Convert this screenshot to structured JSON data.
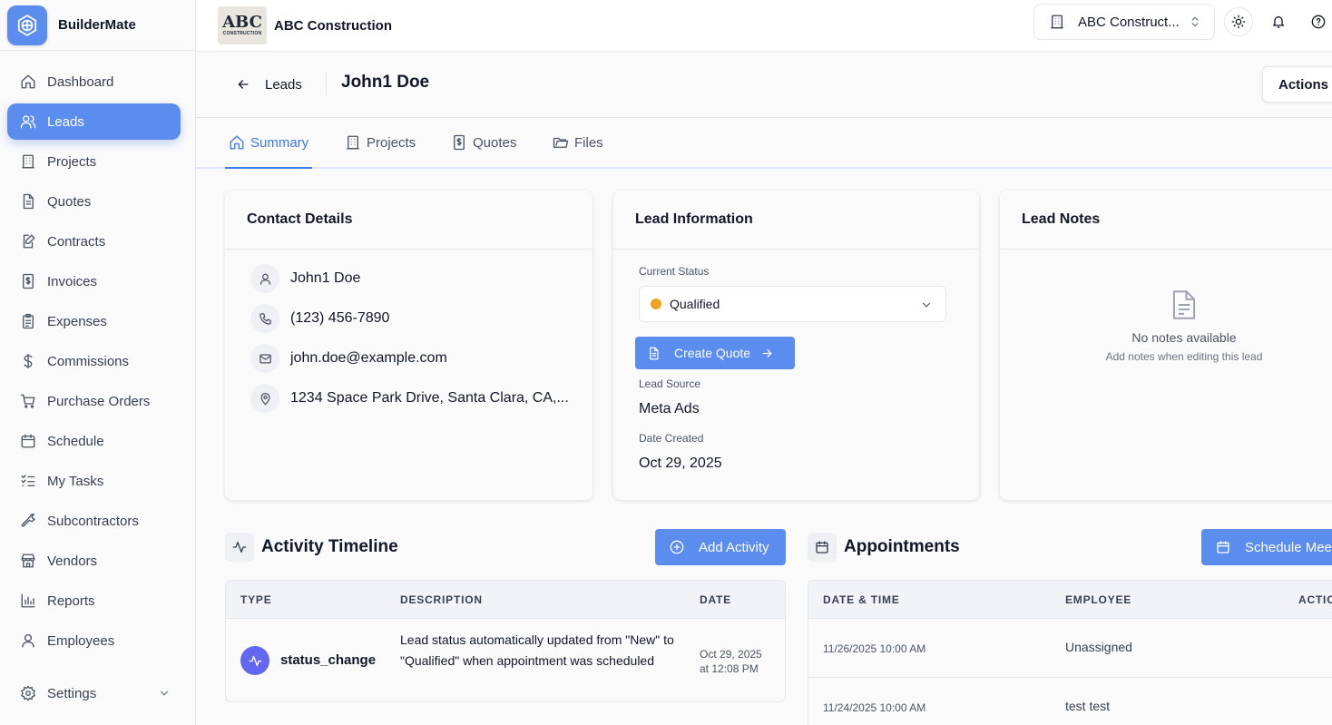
{
  "app": {
    "name": "BuilderMate"
  },
  "sidebar": {
    "items": [
      {
        "label": "Dashboard",
        "icon": "home-icon",
        "active": false
      },
      {
        "label": "Leads",
        "icon": "users-icon",
        "active": true
      },
      {
        "label": "Projects",
        "icon": "building-icon",
        "active": false
      },
      {
        "label": "Quotes",
        "icon": "document-icon",
        "active": false
      },
      {
        "label": "Contracts",
        "icon": "file-pen-icon",
        "active": false
      },
      {
        "label": "Invoices",
        "icon": "dollar-file-icon",
        "active": false
      },
      {
        "label": "Expenses",
        "icon": "clipboard-icon",
        "active": false
      },
      {
        "label": "Commissions",
        "icon": "dollar-icon",
        "active": false
      },
      {
        "label": "Purchase Orders",
        "icon": "cart-icon",
        "active": false
      },
      {
        "label": "Schedule",
        "icon": "calendar-icon",
        "active": false
      },
      {
        "label": "My Tasks",
        "icon": "list-check-icon",
        "active": false
      },
      {
        "label": "Subcontractors",
        "icon": "wrench-icon",
        "active": false
      },
      {
        "label": "Vendors",
        "icon": "store-icon",
        "active": false
      },
      {
        "label": "Reports",
        "icon": "bar-chart-icon",
        "active": false
      },
      {
        "label": "Employees",
        "icon": "user-icon",
        "active": false
      }
    ],
    "settings": {
      "label": "Settings",
      "icon": "gear-icon"
    }
  },
  "topbar": {
    "company_name": "ABC Construction",
    "logo_text": "ABC",
    "logo_subtext": "CONSTRUCTION",
    "company_switcher_label": "ABC Construct..."
  },
  "page": {
    "back_label": "Leads",
    "lead_name": "John1 Doe",
    "actions_label": "Actions"
  },
  "tabs": [
    {
      "label": "Summary",
      "icon": "home-icon",
      "active": true
    },
    {
      "label": "Projects",
      "icon": "building-icon",
      "active": false
    },
    {
      "label": "Quotes",
      "icon": "dollar-file-icon",
      "active": false
    },
    {
      "label": "Files",
      "icon": "folder-icon",
      "active": false
    }
  ],
  "contact": {
    "title": "Contact Details",
    "name": "John1 Doe",
    "phone": "(123) 456-7890",
    "email": "john.doe@example.com",
    "address": "1234 Space Park Drive, Santa Clara, CA,..."
  },
  "lead_info": {
    "title": "Lead Information",
    "status_label": "Current Status",
    "status_value": "Qualified",
    "status_color": "#f0a224",
    "create_quote_label": "Create Quote",
    "source_label": "Lead Source",
    "source_value": "Meta Ads",
    "created_label": "Date Created",
    "created_value": "Oct 29, 2025"
  },
  "notes": {
    "title": "Lead Notes",
    "empty_title": "No notes available",
    "empty_sub": "Add notes when editing this lead"
  },
  "activity": {
    "title": "Activity Timeline",
    "add_label": "Add Activity",
    "columns": [
      "TYPE",
      "DESCRIPTION",
      "DATE"
    ],
    "rows": [
      {
        "type": "status_change",
        "description": "Lead status automatically updated from \"New\" to \"Qualified\" when appointment was scheduled",
        "date_line1": "Oct 29, 2025",
        "date_line2": "at 12:08 PM"
      }
    ]
  },
  "appointments": {
    "title": "Appointments",
    "schedule_label": "Schedule Meeting",
    "columns": [
      "DATE & TIME",
      "EMPLOYEE",
      "ACTIONS"
    ],
    "rows": [
      {
        "datetime": "11/26/2025 10:00 AM",
        "employee": "Unassigned"
      },
      {
        "datetime": "11/24/2025 10:00 AM",
        "employee": "test test"
      }
    ]
  },
  "colors": {
    "accent": "#5b8def",
    "activity_badge": "#6366f1"
  }
}
